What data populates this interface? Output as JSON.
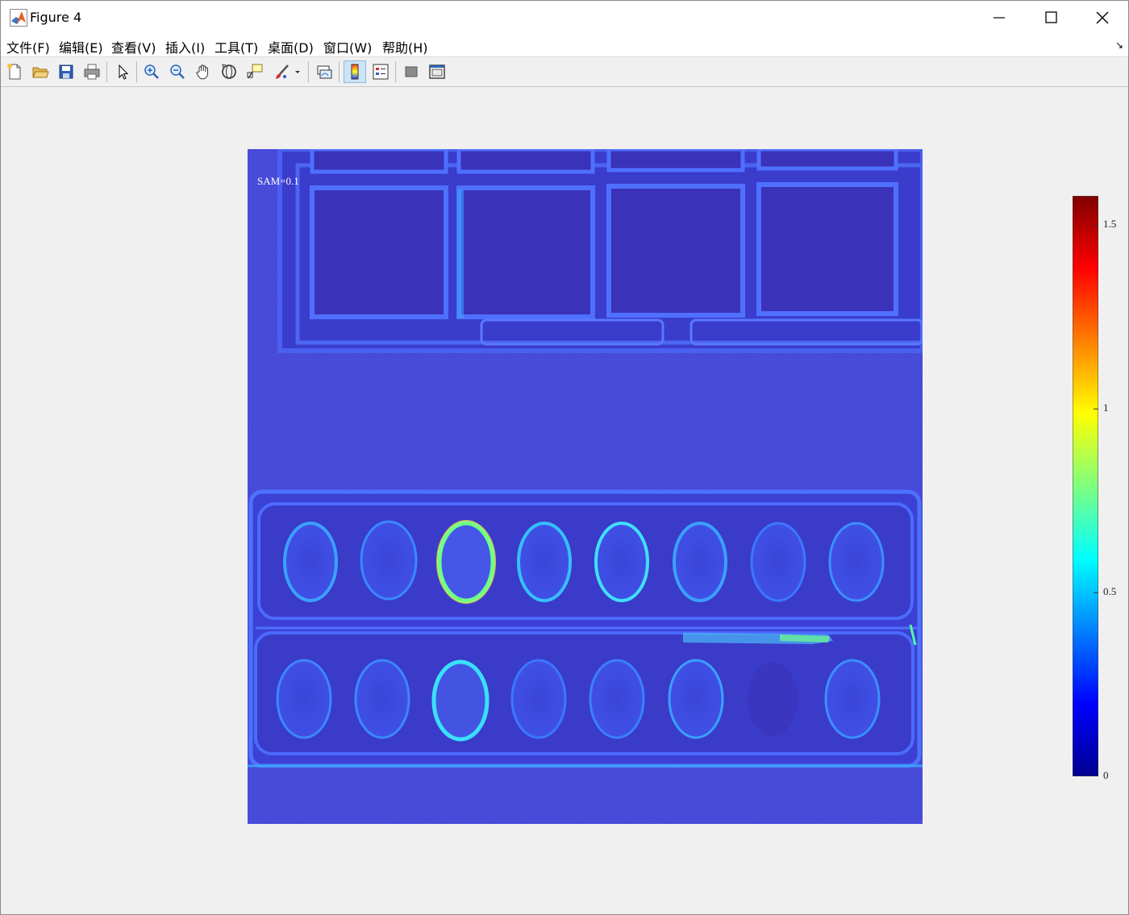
{
  "window": {
    "title": "Figure 4"
  },
  "menu": {
    "items": [
      "文件(F)",
      "编辑(E)",
      "查看(V)",
      "插入(I)",
      "工具(T)",
      "桌面(D)",
      "窗口(W)",
      "帮助(H)"
    ]
  },
  "toolbar": {
    "buttons": [
      {
        "name": "new-figure-icon"
      },
      {
        "name": "open-file-icon"
      },
      {
        "name": "save-icon"
      },
      {
        "name": "print-icon"
      },
      {
        "name": "edit-plot-arrow-icon"
      },
      {
        "name": "zoom-in-icon"
      },
      {
        "name": "zoom-out-icon"
      },
      {
        "name": "pan-hand-icon"
      },
      {
        "name": "rotate-3d-icon"
      },
      {
        "name": "data-cursor-icon"
      },
      {
        "name": "brush-icon"
      },
      {
        "name": "link-plot-icon"
      },
      {
        "name": "insert-colorbar-icon",
        "active": true
      },
      {
        "name": "insert-legend-icon"
      },
      {
        "name": "hide-plot-tools-icon"
      },
      {
        "name": "show-plot-tools-icon"
      }
    ]
  },
  "plot": {
    "annotation": "SAM=0.1",
    "colormap": "jet",
    "colorbar": {
      "ticks": [
        "1.5",
        "1",
        "0.5",
        "0"
      ],
      "values": [
        1.5,
        1,
        0.5,
        0
      ],
      "range": [
        0,
        1.58
      ]
    },
    "colors": {
      "background": "#3a33c4",
      "edge_bright": "#2f6cff",
      "highlight": "#6cff8a"
    }
  }
}
